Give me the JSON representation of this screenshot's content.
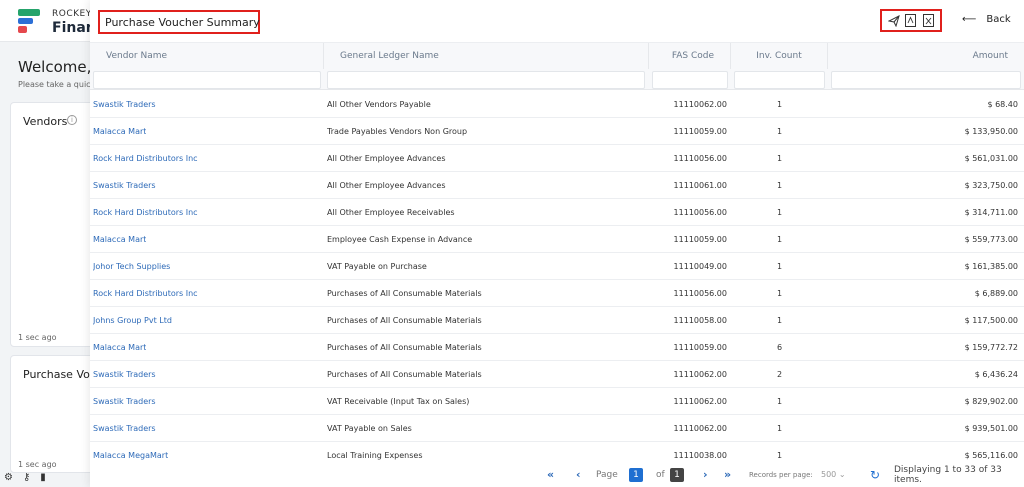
{
  "app": {
    "brand_top": "ROCKEYE",
    "brand_main": "Financ",
    "welcome": "Welcome, Jo",
    "welcome_sub": "Please take a quick",
    "cards": [
      {
        "title": "Vendors",
        "ago": "1 sec ago"
      },
      {
        "title": "Purchase Vouch",
        "ago": "1 sec ago"
      }
    ]
  },
  "modal": {
    "title": "Purchase Voucher Summary",
    "actions": [
      "send-icon",
      "pdf-icon",
      "excel-icon"
    ],
    "back_label": "Back",
    "columns": [
      "Vendor Name",
      "General Ledger Name",
      "FAS Code",
      "Inv. Count",
      "Amount"
    ],
    "rows": [
      {
        "vendor": "Swastik Traders",
        "gl": "All Other Vendors Payable",
        "fas": "11110062.00",
        "count": "1",
        "amount": "$ 68.40"
      },
      {
        "vendor": "Malacca Mart",
        "gl": "Trade Payables Vendors Non Group",
        "fas": "11110059.00",
        "count": "1",
        "amount": "$ 133,950.00"
      },
      {
        "vendor": "Rock Hard Distributors Inc",
        "gl": "All Other Employee Advances",
        "fas": "11110056.00",
        "count": "1",
        "amount": "$ 561,031.00"
      },
      {
        "vendor": "Swastik Traders",
        "gl": "All Other Employee Advances",
        "fas": "11110061.00",
        "count": "1",
        "amount": "$ 323,750.00"
      },
      {
        "vendor": "Rock Hard Distributors Inc",
        "gl": "All Other Employee Receivables",
        "fas": "11110056.00",
        "count": "1",
        "amount": "$ 314,711.00"
      },
      {
        "vendor": "Malacca Mart",
        "gl": "Employee Cash Expense in Advance",
        "fas": "11110059.00",
        "count": "1",
        "amount": "$ 559,773.00"
      },
      {
        "vendor": "Johor Tech Supplies",
        "gl": "VAT Payable on Purchase",
        "fas": "11110049.00",
        "count": "1",
        "amount": "$ 161,385.00"
      },
      {
        "vendor": "Rock Hard Distributors Inc",
        "gl": "Purchases of All Consumable Materials",
        "fas": "11110056.00",
        "count": "1",
        "amount": "$ 6,889.00"
      },
      {
        "vendor": "Johns Group Pvt Ltd",
        "gl": "Purchases of All Consumable Materials",
        "fas": "11110058.00",
        "count": "1",
        "amount": "$ 117,500.00"
      },
      {
        "vendor": "Malacca Mart",
        "gl": "Purchases of All Consumable Materials",
        "fas": "11110059.00",
        "count": "6",
        "amount": "$ 159,772.72"
      },
      {
        "vendor": "Swastik Traders",
        "gl": "Purchases of All Consumable Materials",
        "fas": "11110062.00",
        "count": "2",
        "amount": "$ 6,436.24"
      },
      {
        "vendor": "Swastik Traders",
        "gl": "VAT Receivable (Input Tax on Sales)",
        "fas": "11110062.00",
        "count": "1",
        "amount": "$ 829,902.00"
      },
      {
        "vendor": "Swastik Traders",
        "gl": "VAT Payable on Sales",
        "fas": "11110062.00",
        "count": "1",
        "amount": "$ 939,501.00"
      },
      {
        "vendor": "Malacca MegaMart",
        "gl": "Local Training Expenses",
        "fas": "11110038.00",
        "count": "1",
        "amount": "$ 565,116.00"
      }
    ],
    "pager": {
      "first": "«",
      "prev": "‹",
      "page_label": "Page",
      "current_page": "1",
      "of_label": "of",
      "total_pages": "1",
      "next": "›",
      "last": "»",
      "records_label": "Records per page:",
      "records_value": "500",
      "display_text": "Displaying 1 to 33 of 33 items."
    }
  }
}
